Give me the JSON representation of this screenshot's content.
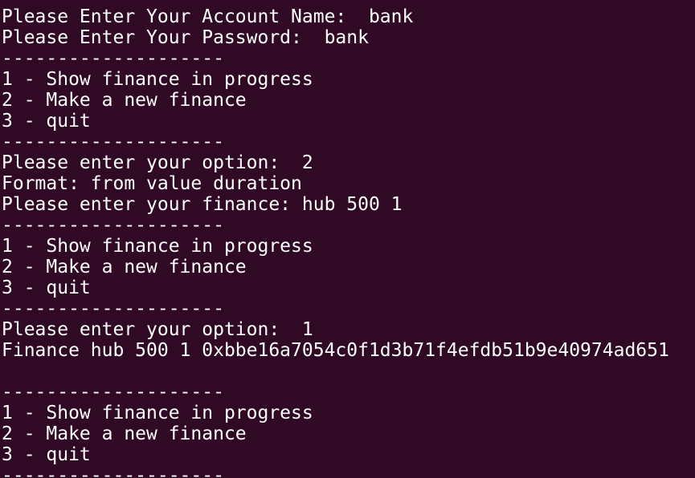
{
  "terminal": {
    "colors": {
      "background": "#300a24",
      "text": "#ffffff",
      "prompt_user": "#8ae234",
      "prompt_path": "#729fcf"
    },
    "lines": [
      "Please Enter Your Account Name:  bank",
      "Please Enter Your Password:  bank",
      "--------------------",
      "1 - Show finance in progress",
      "2 - Make a new finance",
      "3 - quit",
      "--------------------",
      "Please enter your option:  2",
      "Format: from value duration",
      "Please enter your finance: hub 500 1",
      "--------------------",
      "1 - Show finance in progress",
      "2 - Make a new finance",
      "3 - quit",
      "--------------------",
      "Please enter your option:  1",
      "Finance hub 500 1 0xbbe16a7054c0f1d3b71f4efdb51b9e40974ad651",
      "",
      "--------------------",
      "1 - Show finance in progress",
      "2 - Make a new finance",
      "3 - quit",
      "--------------------"
    ]
  }
}
